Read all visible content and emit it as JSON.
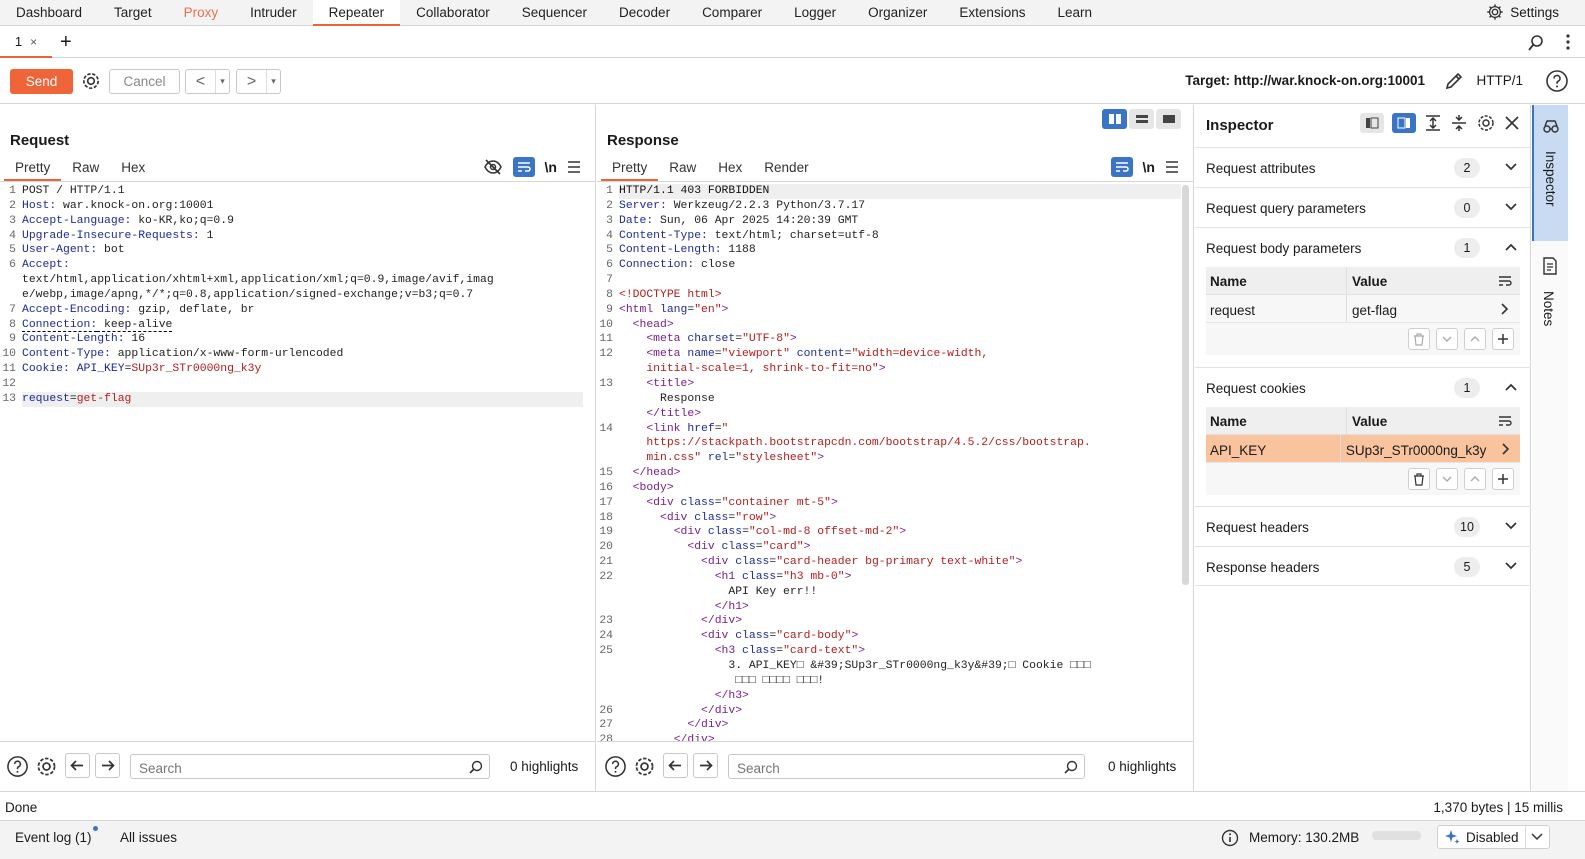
{
  "nav": {
    "tabs": [
      "Dashboard",
      "Target",
      "Proxy",
      "Intruder",
      "Repeater",
      "Collaborator",
      "Sequencer",
      "Decoder",
      "Comparer",
      "Logger",
      "Organizer",
      "Extensions",
      "Learn"
    ],
    "active": "Repeater",
    "settings_label": "Settings"
  },
  "repeater": {
    "tab_label": "1",
    "tab_close": "×",
    "add_tab": "+"
  },
  "toolbar": {
    "send_label": "Send",
    "cancel_label": "Cancel",
    "back": "<",
    "forward": ">",
    "dropdown": "▾",
    "target_label": "Target: http://war.knock-on.org:10001",
    "http_version": "HTTP/1"
  },
  "request": {
    "title": "Request",
    "tabs": [
      "Pretty",
      "Raw",
      "Hex"
    ],
    "newline_label": "\\n",
    "lines": [
      {
        "n": "1",
        "k": "",
        "v": "POST / HTTP/1.1"
      },
      {
        "n": "2",
        "k": "Host:",
        "v": " war.knock-on.org:10001"
      },
      {
        "n": "3",
        "k": "Accept-Language:",
        "v": " ko-KR,ko;q=0.9"
      },
      {
        "n": "4",
        "k": "Upgrade-Insecure-Requests:",
        "v": " 1"
      },
      {
        "n": "5",
        "k": "User-Agent:",
        "v": " bot"
      },
      {
        "n": "6",
        "k": "Accept:",
        "v": ""
      },
      {
        "n": "",
        "k": "",
        "v": "text/html,application/xhtml+xml,application/xml;q=0.9,image/avif,imag"
      },
      {
        "n": "",
        "k": "",
        "v": "e/webp,image/apng,*/*;q=0.8,application/signed-exchange;v=b3;q=0.7"
      },
      {
        "n": "7",
        "k": "Accept-Encoding:",
        "v": " gzip, deflate, br"
      },
      {
        "n": "8",
        "k": "Connection:",
        "v": " keep-alive"
      },
      {
        "n": "9",
        "k": "Content-Length:",
        "v": " 16"
      },
      {
        "n": "10",
        "k": "Content-Type:",
        "v": " application/x-www-form-urlencoded"
      },
      {
        "n": "11",
        "k": "Cookie:",
        "v": " ",
        "ck": "API_KEY",
        "cv": "SUp3r_STr0000ng_k3y"
      },
      {
        "n": "12",
        "k": "",
        "v": ""
      },
      {
        "n": "13",
        "bk": "request",
        "bv": "get-flag"
      }
    ],
    "search_placeholder": "Search",
    "highlights": "0 highlights"
  },
  "response": {
    "title": "Response",
    "tabs": [
      "Pretty",
      "Raw",
      "Hex",
      "Render"
    ],
    "newline_label": "\\n",
    "search_placeholder": "Search",
    "highlights": "0 highlights"
  },
  "inspector": {
    "title": "Inspector",
    "sections": [
      {
        "label": "Request attributes",
        "count": "2"
      },
      {
        "label": "Request query parameters",
        "count": "0"
      },
      {
        "label": "Request body parameters",
        "count": "1"
      },
      {
        "label": "Request cookies",
        "count": "1"
      },
      {
        "label": "Request headers",
        "count": "10"
      },
      {
        "label": "Response headers",
        "count": "5"
      }
    ],
    "name_col": "Name",
    "value_col": "Value",
    "body_param": {
      "name": "request",
      "value": "get-flag"
    },
    "cookie": {
      "name": "API_KEY",
      "value": "SUp3r_STr0000ng_k3y"
    }
  },
  "rail": {
    "inspector": "Inspector",
    "notes": "Notes"
  },
  "status": {
    "left": "Done",
    "right": "1,370 bytes | 15 millis"
  },
  "footer": {
    "event_log": "Event log (1)",
    "all_issues": "All issues",
    "memory": "Memory: 130.2MB",
    "ai_status": "Disabled"
  },
  "colors": {
    "accent": "#e8643c",
    "send": "#f0643a",
    "blue": "#3a74c4",
    "selected_row": "#f9c39d"
  }
}
